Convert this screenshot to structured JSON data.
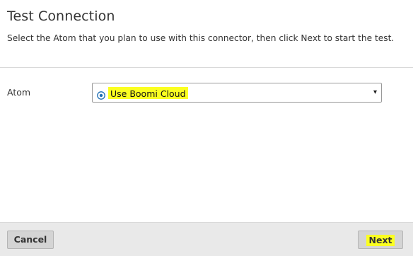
{
  "dialog": {
    "title": "Test Connection",
    "subtitle": "Select the Atom that you plan to use with this connector, then click Next to start the test."
  },
  "form": {
    "atom_label": "Atom",
    "atom_select": {
      "selected_value": "Use Boomi Cloud",
      "icon": "cloud-atom-icon",
      "arrow": "▾"
    }
  },
  "footer": {
    "cancel_label": "Cancel",
    "next_label": "Next"
  },
  "colors": {
    "highlight": "#fbff21",
    "footer_bg": "#e9e9e9",
    "button_bg": "#d4d4d4",
    "text": "#333333"
  }
}
